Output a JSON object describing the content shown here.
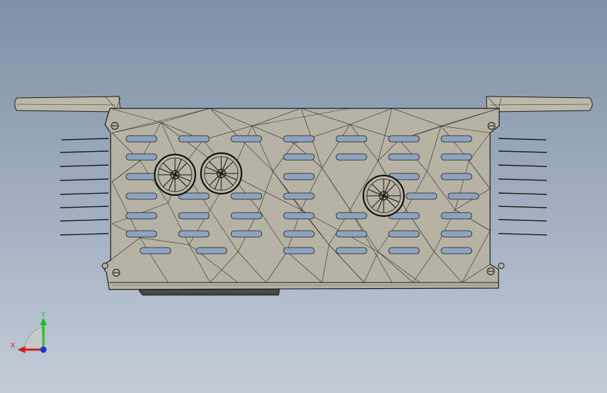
{
  "viewport": {
    "background_top": "#7f90a6",
    "background_bottom": "#c3ccd8"
  },
  "model": {
    "body_color": "#b7b3a4",
    "edge_color": "#1b1b1b",
    "slot_color": "#8ea3bd",
    "fan_count": 3,
    "slot_rows": 6
  },
  "triad": {
    "x_label": "X",
    "y_label": "Y",
    "x_color": "#d21e1e",
    "y_color": "#1fbf2a",
    "z_color": "#1e2fd2"
  }
}
